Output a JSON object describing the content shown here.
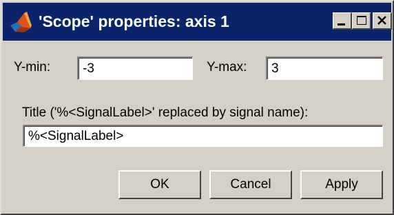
{
  "window": {
    "title": "'Scope' properties: axis 1",
    "icon": "matlab-logo-icon",
    "controls": [
      "minimize-icon",
      "maximize-icon",
      "close-icon"
    ]
  },
  "form": {
    "ymin": {
      "label": "Y-min:",
      "value": "-3"
    },
    "ymax": {
      "label": "Y-max:",
      "value": "3"
    },
    "title_field": {
      "label": "Title ('%<SignalLabel>' replaced by signal name):",
      "value": "%<SignalLabel>"
    }
  },
  "buttons": {
    "ok": "OK",
    "cancel": "Cancel",
    "apply": "Apply"
  },
  "colors": {
    "titlebar": "#0a246a",
    "title_text": "#ffffff",
    "dialog_bg": "#d4d0c8"
  }
}
